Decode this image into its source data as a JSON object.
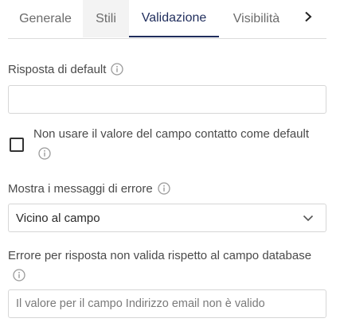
{
  "tabs": [
    {
      "label": "Generale"
    },
    {
      "label": "Stili"
    },
    {
      "label": "Validazione",
      "active": true
    },
    {
      "label": "Visibilità"
    }
  ],
  "default_response": {
    "label": "Risposta di default",
    "value": ""
  },
  "checkbox": {
    "label": "Non usare il valore del campo contatto come default",
    "checked": false
  },
  "error_messages": {
    "label": "Mostra i messaggi di errore",
    "selected": "Vicino al campo"
  },
  "invalid_error": {
    "label": "Errore per risposta non valida rispetto al campo database",
    "placeholder": "Il valore per il campo Indirizzo email non è valido"
  },
  "colors": {
    "active_tab": "#1f2d5c",
    "hover_tab_bg": "#f3f3f3",
    "border": "#d6d6d6"
  },
  "icons": {
    "more_tabs": "chevron-right-icon",
    "info": "info-icon",
    "dropdown": "chevron-down-icon"
  }
}
